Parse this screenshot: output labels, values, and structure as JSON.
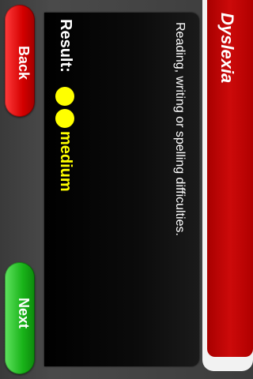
{
  "nav": {
    "back_label": "Back",
    "next_label": "Next"
  },
  "header": {
    "title": "Dyslexia"
  },
  "result": {
    "label": "Result:",
    "level": "medium",
    "rating_filled": 2,
    "description": "Reading, writing or spelling difficulties."
  },
  "colors": {
    "back_button": "#d40000",
    "next_button": "#19b319",
    "rating_dot": "#ffff00",
    "title_tab": "#c40000"
  }
}
